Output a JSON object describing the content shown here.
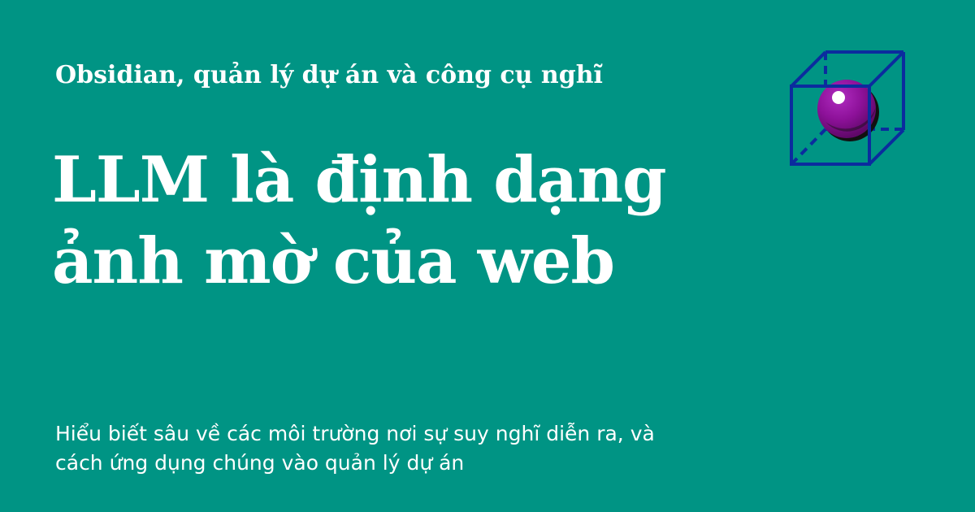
{
  "header": {
    "site_name": "Obsidian, quản lý dự án và công cụ nghĩ"
  },
  "main": {
    "title_lines": [
      "LLM là định dạng",
      "ảnh mờ của web"
    ],
    "description_lines": [
      "Hiểu biết sâu về các môi trường nơi sự suy nghĩ diễn ra, và",
      "cách ứng dụng chúng vào quản lý dự án"
    ]
  },
  "logo": {
    "icon": "cube-with-sphere-icon",
    "colors": {
      "cube": "#0B2C9E",
      "sphere": "#8D1199",
      "sphere_shadow": "#111111",
      "highlight": "#FFFFFF"
    }
  },
  "theme": {
    "background": "#009484",
    "text": "#FFFFFF"
  }
}
